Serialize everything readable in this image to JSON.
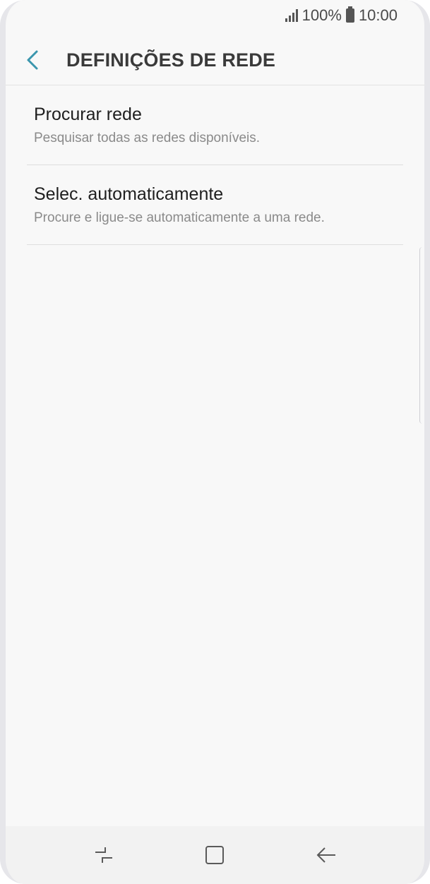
{
  "status_bar": {
    "battery": "100%",
    "time": "10:00"
  },
  "header": {
    "title": "DEFINIÇÕES DE REDE"
  },
  "items": [
    {
      "title": "Procurar rede",
      "subtitle": "Pesquisar todas as redes disponíveis."
    },
    {
      "title": "Selec. automaticamente",
      "subtitle": "Procure e ligue-se automaticamente a uma rede."
    }
  ],
  "colors": {
    "accent": "#3a96ad",
    "background": "#f8f8f8",
    "title_text": "#3a3a3a",
    "secondary_text": "#8a8a8a"
  },
  "icons": {
    "back": "chevron-left-icon",
    "signal": "signal-icon",
    "battery": "battery-icon",
    "nav_recent": "recent-apps-icon",
    "nav_home": "home-icon",
    "nav_back": "back-arrow-icon"
  }
}
